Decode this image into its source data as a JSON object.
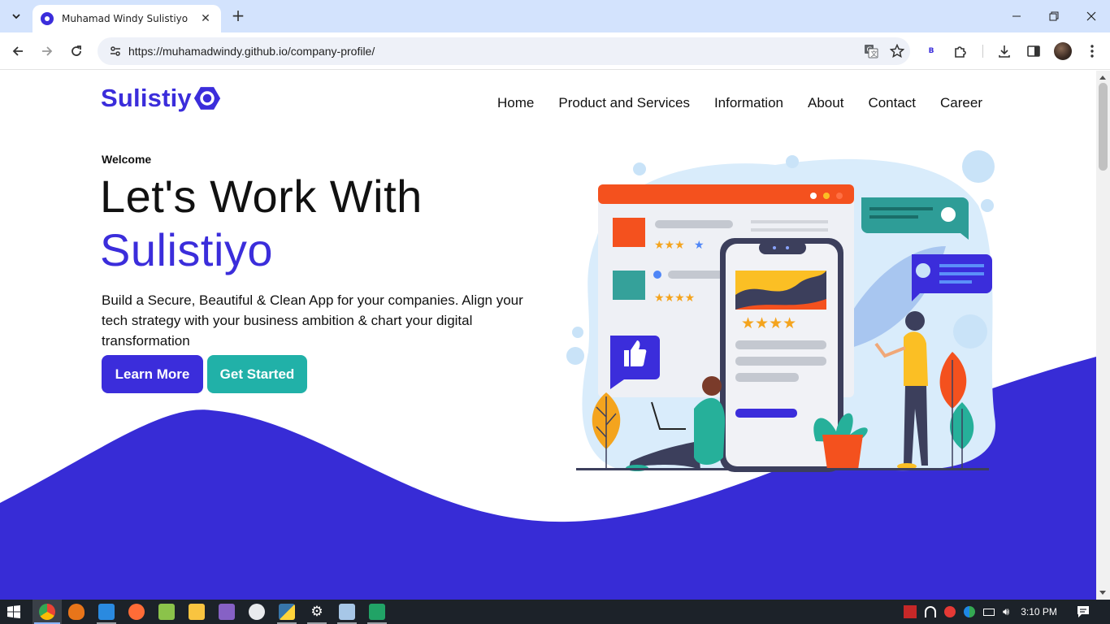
{
  "browser": {
    "tab_title": "Muhamad Windy Sulistiyo",
    "url": "https://muhamadwindy.github.io/company-profile/",
    "extension_badge": "B"
  },
  "site": {
    "logo_text": "Sulistiy",
    "nav": [
      "Home",
      "Product and Services",
      "Information",
      "About",
      "Contact",
      "Career"
    ],
    "hero": {
      "eyebrow": "Welcome",
      "title_line1": "Let's Work With",
      "title_line2": "Sulistiyo",
      "description": "Build a Secure, Beautiful & Clean App for your companies. Align your tech strategy with your business ambition & chart your digital transformation",
      "primary_button": "Learn More",
      "secondary_button": "Get Started"
    },
    "colors": {
      "brand": "#3b2ddb",
      "teal": "#21b1a8",
      "orange": "#f4511e"
    }
  },
  "taskbar": {
    "time": "3:10 PM",
    "apps": [
      "chrome",
      "brave",
      "vscode",
      "postman",
      "notepad",
      "explorer",
      "visual-studio",
      "steam",
      "python",
      "settings",
      "notes",
      "excel"
    ]
  }
}
